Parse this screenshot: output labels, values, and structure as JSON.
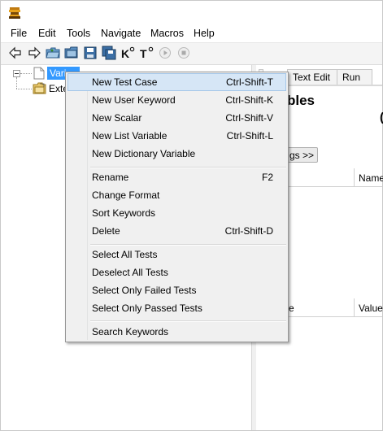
{
  "menubar": {
    "items": [
      "File",
      "Edit",
      "Tools",
      "Navigate",
      "Macros",
      "Help"
    ]
  },
  "toolbar": {
    "buttons": [
      "back-arrow-icon",
      "forward-arrow-icon",
      "open-folder-icon",
      "open-directory-icon",
      "save-icon",
      "save-all-icon",
      "search-keywords-icon",
      "search-tests-icon",
      "run-icon",
      "stop-icon"
    ]
  },
  "tree": {
    "nodes": [
      {
        "label": "Vari",
        "selected": true
      },
      {
        "label": "Exte",
        "selected": false
      }
    ]
  },
  "right_pane": {
    "tabs": [
      "Text Edit",
      "Run"
    ],
    "heading": "bles",
    "heading_tail": "(",
    "tags_button": "gs >>",
    "columns_row1": [
      "Name"
    ],
    "columns_row2": [
      "e",
      "Value"
    ]
  },
  "context_menu": {
    "groups": [
      [
        {
          "label": "New Test Case",
          "shortcut": "Ctrl-Shift-T",
          "highlighted": true
        },
        {
          "label": "New User Keyword",
          "shortcut": "Ctrl-Shift-K"
        },
        {
          "label": "New Scalar",
          "shortcut": "Ctrl-Shift-V"
        },
        {
          "label": "New List Variable",
          "shortcut": "Ctrl-Shift-L"
        },
        {
          "label": "New Dictionary Variable",
          "shortcut": ""
        }
      ],
      [
        {
          "label": "Rename",
          "shortcut": "F2"
        },
        {
          "label": "Change Format",
          "shortcut": ""
        },
        {
          "label": "Sort Keywords",
          "shortcut": ""
        },
        {
          "label": "Delete",
          "shortcut": "Ctrl-Shift-D"
        }
      ],
      [
        {
          "label": "Select All Tests",
          "shortcut": ""
        },
        {
          "label": "Deselect All Tests",
          "shortcut": ""
        },
        {
          "label": "Select Only Failed Tests",
          "shortcut": ""
        },
        {
          "label": "Select Only Passed Tests",
          "shortcut": ""
        }
      ],
      [
        {
          "label": "Search Keywords",
          "shortcut": ""
        }
      ]
    ]
  },
  "colors": {
    "selection": "#3399ff",
    "menu_highlight": "#d6e6f6",
    "menu_highlight_border": "#a4c6e8",
    "menu_bg": "#f0f0f0"
  }
}
